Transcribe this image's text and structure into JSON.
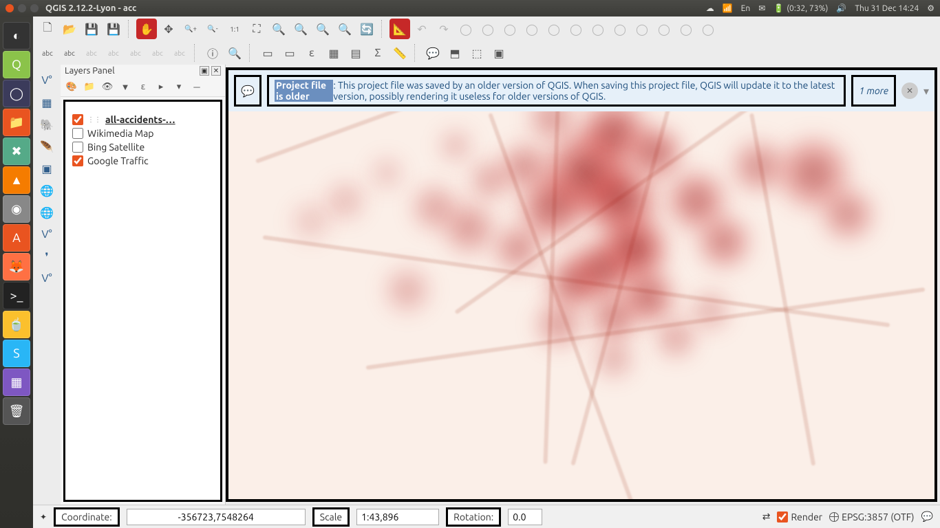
{
  "system": {
    "title": "QGIS 2.12.2-Lyon - acc",
    "lang": "En",
    "battery": "(0:32, 73%)",
    "datetime": "Thu 31 Dec 14:24"
  },
  "launcher_apps": [
    "dash",
    "qgis",
    "eclipse",
    "files",
    "tools",
    "vlc",
    "disk",
    "software",
    "firefox",
    "terminal",
    "tea",
    "bt",
    "app",
    "trash"
  ],
  "toolbar1": [
    {
      "name": "new-project-icon",
      "glyph": "🗋"
    },
    {
      "name": "open-project-icon",
      "glyph": "📂"
    },
    {
      "name": "save-project-icon",
      "glyph": "💾"
    },
    {
      "name": "save-as-icon",
      "glyph": "💾"
    },
    {
      "sep": true
    },
    {
      "name": "pan-icon",
      "glyph": "✋",
      "cls": "red"
    },
    {
      "name": "pan-selection-icon",
      "glyph": "✥"
    },
    {
      "name": "zoom-in-icon",
      "glyph": "🔍+"
    },
    {
      "name": "zoom-out-icon",
      "glyph": "🔍-"
    },
    {
      "name": "zoom-native-icon",
      "glyph": "1:1"
    },
    {
      "name": "zoom-full-icon",
      "glyph": "⛶"
    },
    {
      "name": "zoom-selection-icon",
      "glyph": "🔍"
    },
    {
      "name": "zoom-layer-icon",
      "glyph": "🔍"
    },
    {
      "name": "zoom-last-icon",
      "glyph": "🔍"
    },
    {
      "name": "zoom-next-icon",
      "glyph": "🔍"
    },
    {
      "name": "refresh-icon",
      "glyph": "🔄"
    },
    {
      "sep": true
    },
    {
      "name": "ruler-icon",
      "glyph": "📐",
      "cls": "red"
    },
    {
      "name": "undo-icon",
      "glyph": "↶",
      "cls": "disabled"
    },
    {
      "name": "redo-icon",
      "glyph": "↷",
      "cls": "disabled"
    },
    {
      "name": "edit-icon",
      "glyph": "◯",
      "cls": "disabled"
    },
    {
      "name": "edit2-icon",
      "glyph": "◯",
      "cls": "disabled"
    },
    {
      "name": "edit3-icon",
      "glyph": "◯",
      "cls": "disabled"
    },
    {
      "name": "edit4-icon",
      "glyph": "◯",
      "cls": "disabled"
    },
    {
      "name": "edit5-icon",
      "glyph": "◯",
      "cls": "disabled"
    },
    {
      "name": "edit6-icon",
      "glyph": "◯",
      "cls": "disabled"
    },
    {
      "name": "edit7-icon",
      "glyph": "◯",
      "cls": "disabled"
    },
    {
      "name": "edit8-icon",
      "glyph": "◯",
      "cls": "disabled"
    },
    {
      "name": "edit9-icon",
      "glyph": "◯",
      "cls": "disabled"
    },
    {
      "name": "edit10-icon",
      "glyph": "◯",
      "cls": "disabled"
    },
    {
      "name": "edit11-icon",
      "glyph": "◯",
      "cls": "disabled"
    },
    {
      "name": "edit12-icon",
      "glyph": "◯",
      "cls": "disabled"
    }
  ],
  "toolbar2": [
    {
      "name": "label-abc1-icon",
      "glyph": "abc"
    },
    {
      "name": "label-abc2-icon",
      "glyph": "abc"
    },
    {
      "name": "label-abc3-icon",
      "glyph": "abc",
      "cls": "disabled"
    },
    {
      "name": "label-abc4-icon",
      "glyph": "abc",
      "cls": "disabled"
    },
    {
      "name": "label-abc5-icon",
      "glyph": "abc",
      "cls": "disabled"
    },
    {
      "name": "label-abc6-icon",
      "glyph": "abc",
      "cls": "disabled"
    },
    {
      "name": "label-abc7-icon",
      "glyph": "abc",
      "cls": "disabled"
    },
    {
      "sep": true
    },
    {
      "name": "identify-icon",
      "glyph": "ⓘ"
    },
    {
      "name": "select-zoom-icon",
      "glyph": "🔍"
    },
    {
      "sep": true
    },
    {
      "name": "select-rect-icon",
      "glyph": "▭"
    },
    {
      "name": "select-poly-icon",
      "glyph": "▭"
    },
    {
      "name": "select-expr-icon",
      "glyph": "ε"
    },
    {
      "name": "attr-table-icon",
      "glyph": "▦"
    },
    {
      "name": "field-calc-icon",
      "glyph": "▤"
    },
    {
      "name": "sum-icon",
      "glyph": "Σ"
    },
    {
      "name": "measure-icon",
      "glyph": "📏"
    },
    {
      "sep": true
    },
    {
      "name": "map-tips-icon",
      "glyph": "💬"
    },
    {
      "name": "bookmark-icon",
      "glyph": "⬒"
    },
    {
      "name": "bookmark2-icon",
      "glyph": "⬚"
    },
    {
      "name": "bookmark3-icon",
      "glyph": "▣"
    }
  ],
  "left_tools": [
    "add-vector-icon",
    "add-raster-icon",
    "add-postgis-icon",
    "add-spatialite-icon",
    "add-wms-icon",
    "add-csv-icon",
    "add-wfs-icon",
    "add-virtual-icon",
    "add-group-icon",
    "add-delimited-icon"
  ],
  "layers_panel": {
    "title": "Layers Panel",
    "items": [
      {
        "checked": true,
        "label": "all-accidents-…",
        "active": true
      },
      {
        "checked": false,
        "label": "Wikimedia Map"
      },
      {
        "checked": false,
        "label": "Bing Satellite"
      },
      {
        "checked": true,
        "label": "Google Traffic"
      }
    ]
  },
  "notice": {
    "bold": "Project file is older",
    "text": ": This project file was saved by an older version of QGIS. When saving this project file, QGIS will update it to the latest version, possibly rendering it useless for older versions of QGIS.",
    "more": "1 more"
  },
  "status": {
    "coord_label": "Coordinate:",
    "coord_value": "-356723,7548264",
    "scale_label": "Scale",
    "scale_value": "1:43,896",
    "rotation_label": "Rotation:",
    "rotation_value": "0.0",
    "render_label": "Render",
    "crs": "EPSG:3857 (OTF)"
  }
}
